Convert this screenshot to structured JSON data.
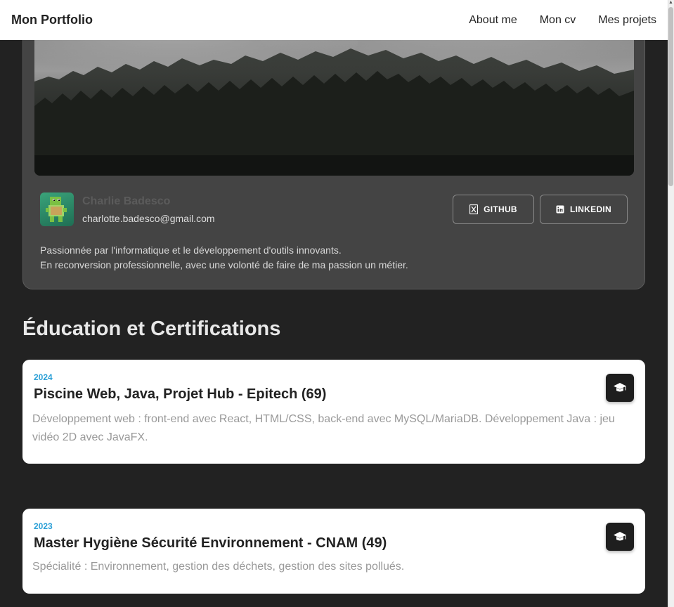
{
  "nav": {
    "brand": "Mon Portfolio",
    "links": [
      "About me",
      "Mon cv",
      "Mes projets"
    ]
  },
  "profile": {
    "name": "Charlie Badesco",
    "email": "charlotte.badesco@gmail.com",
    "github_label": "GITHUB",
    "linkedin_label": "LINKEDIN",
    "bio_line1": "Passionnée par l'informatique et le développement d'outils innovants.",
    "bio_line2": "En reconversion professionnelle, avec une volonté de faire de ma passion un métier.",
    "avatar_icon": "pixel-turtle-avatar-icon"
  },
  "education": {
    "title": "Éducation et Certifications",
    "items": [
      {
        "year": "2024",
        "title": "Piscine Web, Java, Projet Hub - Epitech (69)",
        "description": "Développement web : front-end avec React, HTML/CSS, back-end avec MySQL/MariaDB. Développement Java : jeu vidéo 2D avec JavaFX.",
        "icon": "graduation-cap-icon"
      },
      {
        "year": "2023",
        "title": "Master Hygiène Sécurité Environnement - CNAM (49)",
        "description": "Spécialité : Environnement, gestion des déchets, gestion des sites pollués.",
        "icon": "graduation-cap-icon"
      }
    ]
  },
  "colors": {
    "page_background": "#222222",
    "card_background": "#444444",
    "accent_year": "#2a9fd6"
  }
}
